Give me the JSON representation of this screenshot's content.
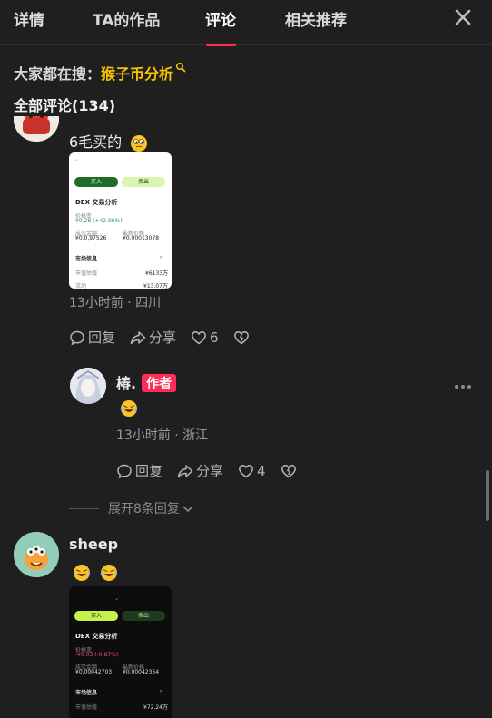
{
  "tabs": [
    {
      "label": "详情",
      "active": false
    },
    {
      "label": "TA的作品",
      "active": false
    },
    {
      "label": "评论",
      "active": true
    },
    {
      "label": "相关推荐",
      "active": false
    }
  ],
  "search_hint": {
    "prefix": "大家都在搜：",
    "keyword": "猴子币分析"
  },
  "comments_header": "全部评论(134)",
  "comments": [
    {
      "text": "6毛买的",
      "emoji": "thinking-face",
      "meta": "13小时前 · 四川",
      "reply_label": "回复",
      "share_label": "分享",
      "likes": "6",
      "thumb": {
        "buy": "买入",
        "sell": "卖出",
        "title": "DEX 交易分析",
        "price_label": "价格变",
        "price_value": "¥0.28 (+42.96%)",
        "left_label": "成交金额",
        "left_value": "¥0.0,97526",
        "right_label": "最新价格",
        "right_value": "¥0.00013078",
        "market_label": "市场信息",
        "row1_label": "市值估值",
        "row1_value": "¥6133万",
        "row2_label": "流动",
        "row2_value": "¥13.07万"
      }
    },
    {
      "username": "椿.",
      "badge": "作者",
      "emoji": "rofl-face",
      "meta": "13小时前 · 浙江",
      "reply_label": "回复",
      "share_label": "分享",
      "likes": "4"
    },
    {
      "expand_label": "展开8条回复"
    },
    {
      "username": "sheep",
      "emojis": [
        "rofl-face",
        "rofl-face"
      ],
      "thumb": {
        "buy": "买入",
        "sell": "卖出",
        "title": "DEX 交易分析",
        "price_label": "价格变",
        "price_value": "-¥0.03 (-0.87%)",
        "left_label": "成交金额",
        "left_value": "¥0.00042703",
        "right_label": "最新价格",
        "right_value": "¥0.00042354",
        "market_label": "市场信息",
        "row1_label": "市值估值",
        "row1_value": "¥72.24万"
      }
    }
  ],
  "colors": {
    "accent": "#ff2d55",
    "keyword": "#f5c400",
    "background": "#1f1f1f"
  }
}
